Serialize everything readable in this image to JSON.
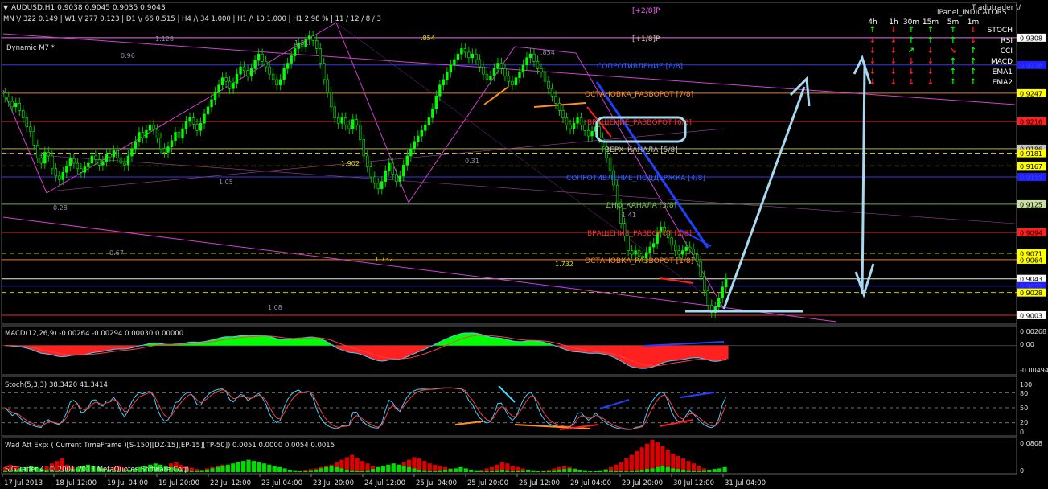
{
  "header": {
    "symbol_line": "AUDUSD,H1  0.9038 0.9045 0.9035 0.9043",
    "stats_line": "MN \\/ 322   0.149  |  W1 \\/ 277   0.123  |  D1 \\/ 66   0.515  |  H4 /\\ 34   1.000  |  H1 /\\ 10   1.000  |  H1  2.98 %  |  11 / 12 / 8 / 3",
    "indicator_name": "Dynamic  M7   *",
    "top_label": "[+2/8]P",
    "second_label": "[+1/8]P",
    "ipanel_title": "iPanel_INDICATORS",
    "tradotrader": "Tradotrader  \\/"
  },
  "ipanel": {
    "timeframes": [
      "4h",
      "1h",
      "30m",
      "15m",
      "5m",
      "1m"
    ],
    "rows": [
      {
        "name": "STOCH",
        "signals": [
          "up",
          "down",
          "up",
          "up",
          "up",
          "down"
        ]
      },
      {
        "name": "RSI",
        "signals": [
          "down",
          "down",
          "up",
          "up",
          "up",
          "down"
        ]
      },
      {
        "name": "CCI",
        "signals": [
          "down",
          "down",
          "upright",
          "down",
          "downright",
          "up"
        ]
      },
      {
        "name": "MACD",
        "signals": [
          "down",
          "down",
          "down",
          "down",
          "up",
          "up"
        ]
      },
      {
        "name": "EMA1",
        "signals": [
          "down",
          "down",
          "down",
          "down",
          "up",
          "up"
        ]
      },
      {
        "name": "EMA2",
        "signals": [
          "down",
          "down",
          "down",
          "down",
          "up",
          "up"
        ]
      }
    ],
    "colors": {
      "up": "#00ff00",
      "down": "#ff2020"
    }
  },
  "chart_data": [
    {
      "type": "line",
      "title": "AUDUSD,H1",
      "ylim": [
        0.8995,
        0.9345
      ],
      "price_levels": [
        {
          "label": "0.9308",
          "value": 0.9308,
          "color": "#ff80ff",
          "box": "#ffffff",
          "text": "#000"
        },
        {
          "label": "0.9278",
          "value": 0.9278,
          "color": "#4040ff",
          "box": "#2020ff",
          "text": "#4040ff"
        },
        {
          "label": "0.9247",
          "value": 0.9247,
          "color": "#ff9030",
          "box": "#ffff00",
          "text": "#000"
        },
        {
          "label": "0.9216",
          "value": 0.9216,
          "color": "#ff3030",
          "box": "#ff2020",
          "text": "#000"
        },
        {
          "label": "0.9186",
          "value": 0.9186,
          "color": "#c0c060",
          "box": "#c8c8c8",
          "text": "#000"
        },
        {
          "label": "0.9181",
          "value": 0.9181,
          "color": "#e0e000",
          "box": "#ffff00",
          "text": "#000"
        },
        {
          "label": "0.9167",
          "value": 0.9167,
          "color": "#e0e000",
          "box": "#ffff00",
          "text": "#000"
        },
        {
          "label": "0.9155",
          "value": 0.9155,
          "color": "#4040ff",
          "box": "#2020ff",
          "text": "#4040ff"
        },
        {
          "label": "0.9125",
          "value": 0.9125,
          "color": "#80c060",
          "box": "#c8e0a0",
          "text": "#000"
        },
        {
          "label": "0.9094",
          "value": 0.9094,
          "color": "#ff3030",
          "box": "#ff2020",
          "text": "#000"
        },
        {
          "label": "0.9071",
          "value": 0.9071,
          "color": "#e0e000",
          "box": "#ffff00",
          "text": "#000"
        },
        {
          "label": "0.9064",
          "value": 0.9064,
          "color": "#ff9030",
          "box": "#ffff00",
          "text": "#000"
        },
        {
          "label": "0.9043",
          "value": 0.9043,
          "color": "#ffffff",
          "box": "#ffffff",
          "text": "#000"
        },
        {
          "label": "0.9035",
          "value": 0.9035,
          "color": "#4040ff",
          "box": "#2020ff",
          "text": "#4040ff"
        },
        {
          "label": "0.9028",
          "value": 0.9028,
          "color": "#e0e000",
          "box": "#ffff00",
          "text": "#000"
        },
        {
          "label": "0.9003",
          "value": 0.9003,
          "color": "#ff3030",
          "box": "#ffffff",
          "text": "#000"
        }
      ],
      "murrey_labels": [
        {
          "text": "СОПРОТИВЛЕНИЕ [8/8]",
          "value": 0.9278,
          "color": "#3060ff"
        },
        {
          "text": "ОСТАНОВКА_РАЗВОРОТ [7/8]",
          "value": 0.9247,
          "color": "#ff9030"
        },
        {
          "text": "ВРАЩЕНИЕ_РАЗВОРОТ [6/8]",
          "value": 0.9216,
          "color": "#ff3030"
        },
        {
          "text": "ВЕРХ_КАНАЛА [5/8]",
          "value": 0.9186,
          "color": "#c0c0c0"
        },
        {
          "text": "СОПРОТИВЛЕНИЕ_ПОДДЕРЖКА [4/8]",
          "value": 0.9155,
          "color": "#3060ff"
        },
        {
          "text": "ДНО_КАНАЛА [3/8]",
          "value": 0.9125,
          "color": "#80c060"
        },
        {
          "text": "ВРАЩЕНИЕ_РАЗВОРОТ [2/8]",
          "value": 0.9094,
          "color": "#ff3030"
        },
        {
          "text": "ОСТАНОВКА_РАЗВОРОТ [1/8]",
          "value": 0.9064,
          "color": "#ff9030"
        }
      ],
      "fib_labels": [
        "1.128",
        "1.51",
        ".854",
        ".854",
        "0.96",
        "1.902",
        "0.31",
        "0.28",
        "1.05",
        "0.67",
        "1.732",
        "1.732",
        "1.08",
        "1.41"
      ],
      "close": [
        0.9243,
        0.9238,
        0.9232,
        0.9236,
        0.9228,
        0.922,
        0.921,
        0.9205,
        0.919,
        0.9176,
        0.917,
        0.9182,
        0.9178,
        0.9164,
        0.9156,
        0.9152,
        0.916,
        0.9167,
        0.9175,
        0.917,
        0.9164,
        0.916,
        0.9166,
        0.917,
        0.9178,
        0.9174,
        0.9168,
        0.9172,
        0.918,
        0.9177,
        0.9184,
        0.9176,
        0.917,
        0.9168,
        0.9178,
        0.9186,
        0.9194,
        0.9204,
        0.9198,
        0.9206,
        0.9212,
        0.9207,
        0.9198,
        0.9186,
        0.9182,
        0.9188,
        0.9195,
        0.9204,
        0.9198,
        0.9208,
        0.9216,
        0.922,
        0.9213,
        0.9206,
        0.9214,
        0.9224,
        0.9232,
        0.924,
        0.9248,
        0.9256,
        0.9264,
        0.926,
        0.9252,
        0.9258,
        0.9268,
        0.9276,
        0.9272,
        0.9266,
        0.9274,
        0.9283,
        0.929,
        0.9282,
        0.9276,
        0.9268,
        0.9262,
        0.9256,
        0.9262,
        0.9274,
        0.928,
        0.9288,
        0.9296,
        0.9302,
        0.9298,
        0.9306,
        0.931,
        0.9305,
        0.9296,
        0.928,
        0.9262,
        0.9248,
        0.9232,
        0.922,
        0.9214,
        0.922,
        0.9212,
        0.9208,
        0.9218,
        0.9212,
        0.9196,
        0.9178,
        0.9166,
        0.9155,
        0.9148,
        0.9142,
        0.915,
        0.9162,
        0.917,
        0.9158,
        0.915,
        0.9156,
        0.9168,
        0.9178,
        0.9186,
        0.9194,
        0.92,
        0.9206,
        0.9212,
        0.922,
        0.923,
        0.9244,
        0.9256,
        0.9262,
        0.927,
        0.9278,
        0.9284,
        0.929,
        0.9296,
        0.9292,
        0.9286,
        0.929,
        0.9284,
        0.9276,
        0.9268,
        0.9262,
        0.9266,
        0.9274,
        0.928,
        0.9274,
        0.9266,
        0.926,
        0.9256,
        0.9264,
        0.927,
        0.9278,
        0.9286,
        0.929,
        0.9282,
        0.9274,
        0.927,
        0.926,
        0.9252,
        0.9244,
        0.9236,
        0.9228,
        0.922,
        0.9212,
        0.9208,
        0.9214,
        0.922,
        0.9212,
        0.9206,
        0.92,
        0.9205,
        0.921,
        0.9198,
        0.9188,
        0.9176,
        0.9162,
        0.9146,
        0.9125,
        0.9104,
        0.909,
        0.9074,
        0.907,
        0.9074,
        0.9068,
        0.9066,
        0.9072,
        0.9078,
        0.9082,
        0.9094,
        0.91,
        0.9096,
        0.9088,
        0.908,
        0.9074,
        0.907,
        0.9074,
        0.9078,
        0.9076,
        0.907,
        0.9062,
        0.9046,
        0.903,
        0.9014,
        0.9006,
        0.9012,
        0.9022,
        0.9034,
        0.9043
      ]
    },
    {
      "type": "line",
      "title": "MACD(12,26,9) -0.00264 -0.00294 0.00030 0.00000",
      "ylim": [
        -0.0054,
        0.0034
      ],
      "tick_labels": [
        "0.00268",
        "0.00",
        "-0.00494"
      ]
    },
    {
      "type": "line",
      "title": "Stoch(5,3,3) 38.3420 41.3414",
      "ylim": [
        0,
        100
      ],
      "tick_labels": [
        "100",
        "80",
        "50",
        "20",
        "0"
      ],
      "levels": [
        80,
        50,
        20
      ]
    },
    {
      "type": "bar",
      "title": "Wad Att Exp: ( Current TimeFrame )[S-150][DZ-15][EP-15][TP-50]) 0.0051 0.0000 0.0054 0.0015",
      "ylim": [
        0,
        0.0808
      ],
      "tick_labels": [
        "0.0808",
        "0"
      ],
      "red": [
        8,
        12,
        10,
        6,
        4,
        3,
        2,
        5,
        9,
        14,
        18,
        22,
        12,
        8,
        6,
        4,
        3,
        2,
        2,
        3,
        5,
        8,
        10,
        6,
        4,
        3,
        2,
        2,
        4,
        6,
        8,
        10,
        14,
        16,
        12,
        9,
        7,
        5,
        4,
        6,
        8,
        10,
        12,
        9,
        8,
        6,
        5,
        4,
        3,
        2,
        3,
        4,
        5,
        4,
        3,
        2,
        2,
        3,
        4,
        5,
        6,
        8,
        10,
        12,
        16,
        20,
        24,
        28,
        22,
        18,
        14,
        10,
        8,
        6,
        5,
        8,
        12,
        16,
        20,
        24,
        22,
        18,
        14,
        12,
        10,
        8,
        6,
        4,
        3,
        2,
        2,
        3,
        4,
        6,
        8,
        12,
        16,
        14,
        10,
        8,
        6,
        4,
        3,
        2,
        3,
        4,
        6,
        8,
        10,
        8,
        6,
        4,
        3,
        2,
        2,
        3,
        5,
        8,
        12,
        16,
        22,
        28,
        34,
        40,
        46,
        52,
        48,
        42,
        36,
        30,
        26,
        22,
        18,
        14,
        10,
        6,
        4,
        3,
        2,
        2
      ],
      "green": [
        2,
        3,
        4,
        6,
        8,
        10,
        8,
        6,
        4,
        3,
        2,
        2,
        3,
        5,
        8,
        10,
        12,
        10,
        8,
        6,
        4,
        3,
        2,
        3,
        4,
        6,
        8,
        10,
        12,
        14,
        12,
        10,
        8,
        6,
        4,
        3,
        2,
        2,
        3,
        4,
        6,
        8,
        10,
        12,
        14,
        16,
        18,
        20,
        18,
        16,
        14,
        12,
        10,
        8,
        6,
        4,
        3,
        2,
        2,
        3,
        4,
        6,
        8,
        10,
        8,
        6,
        4,
        3,
        2,
        2,
        3,
        5,
        8,
        10,
        12,
        14,
        12,
        10,
        8,
        6,
        4,
        3,
        2,
        2,
        3,
        4,
        5,
        6,
        8,
        6,
        4,
        3,
        2,
        2,
        2,
        3,
        4,
        3,
        2,
        2,
        3,
        4,
        3,
        2,
        2,
        2,
        3,
        4,
        5,
        6,
        5,
        4,
        3,
        2,
        2,
        3,
        4,
        3,
        2,
        2,
        2,
        2,
        3,
        4,
        5,
        6,
        8,
        10,
        8,
        6,
        5,
        4,
        3,
        2,
        2,
        3,
        4,
        5,
        6,
        8
      ]
    }
  ],
  "x_axis": {
    "labels": [
      "17 Jul 2013",
      "18 Jul 12:00",
      "19 Jul 04:00",
      "19 Jul 20:00",
      "22 Jul 12:00",
      "23 Jul 04:00",
      "23 Jul 20:00",
      "24 Jul 12:00",
      "25 Jul 04:00",
      "25 Jul 20:00",
      "26 Jul 12:00",
      "29 Jul 04:00",
      "29 Jul 20:00",
      "30 Jul 12:00",
      "31 Jul 04:00"
    ]
  },
  "footer": {
    "copyright": "SIGTrader 4, © 2001-2013 MetaQuotes Software Corp."
  }
}
